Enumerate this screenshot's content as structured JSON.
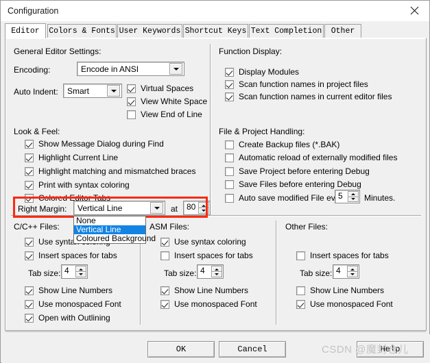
{
  "window": {
    "title": "Configuration",
    "close_icon": "close-icon"
  },
  "tabs": [
    {
      "label": "Editor",
      "active": true
    },
    {
      "label": "Colors & Fonts",
      "active": false
    },
    {
      "label": "User Keywords",
      "active": false
    },
    {
      "label": "Shortcut Keys",
      "active": false
    },
    {
      "label": "Text Completion",
      "active": false
    },
    {
      "label": "Other",
      "active": false
    }
  ],
  "general_editor": {
    "group_label": "General Editor Settings:",
    "encoding_label": "Encoding:",
    "encoding_value": "Encode in ANSI",
    "auto_indent_label": "Auto Indent:",
    "auto_indent_value": "Smart",
    "checks": [
      {
        "label": "Virtual Spaces",
        "checked": true
      },
      {
        "label": "View White Space",
        "checked": true
      },
      {
        "label": "View End of Line",
        "checked": false
      }
    ]
  },
  "function_display": {
    "group_label": "Function Display:",
    "checks": [
      {
        "label": "Display Modules",
        "checked": true
      },
      {
        "label": "Scan function names in project files",
        "checked": true
      },
      {
        "label": "Scan function names in current editor files",
        "checked": true
      }
    ]
  },
  "look_feel": {
    "group_label": "Look & Feel:",
    "checks": [
      {
        "label": "Show Message Dialog during Find",
        "checked": true
      },
      {
        "label": "Highlight Current Line",
        "checked": true
      },
      {
        "label": "Highlight matching and mismatched braces",
        "checked": true
      },
      {
        "label": "Print with syntax coloring",
        "checked": true
      },
      {
        "label": "Colored Editor Tabs",
        "checked": true
      }
    ],
    "right_margin_label": "Right Margin:",
    "right_margin_value": "Vertical Line",
    "at_label": "at",
    "at_value": "80",
    "dropdown_open": true,
    "dropdown_options": [
      {
        "label": "None",
        "selected": false
      },
      {
        "label": "Vertical Line",
        "selected": true
      },
      {
        "label": "Coloured Background",
        "selected": false
      }
    ]
  },
  "file_project": {
    "group_label": "File & Project Handling:",
    "checks": [
      {
        "label": "Create Backup files (*.BAK)",
        "checked": false
      },
      {
        "label": "Automatic reload of externally modified files",
        "checked": false
      },
      {
        "label": "Save Project before entering Debug",
        "checked": false
      },
      {
        "label": "Save Files before entering Debug",
        "checked": false
      },
      {
        "label": "Auto save modified File every",
        "checked": false
      }
    ],
    "autosave_minutes": "5",
    "autosave_suffix": "Minutes."
  },
  "cpp_files": {
    "group_label": "C/C++ Files:",
    "checks_top": [
      {
        "label": "Use syntax coloring",
        "checked": true
      },
      {
        "label": "Insert spaces for tabs",
        "checked": true
      }
    ],
    "tab_size_label": "Tab size:",
    "tab_size_value": "4",
    "checks_bottom": [
      {
        "label": "Show Line Numbers",
        "checked": true
      },
      {
        "label": "Use monospaced Font",
        "checked": true
      },
      {
        "label": "Open with Outlining",
        "checked": true
      }
    ]
  },
  "asm_files": {
    "group_label": "ASM Files:",
    "checks_top": [
      {
        "label": "Use syntax coloring",
        "checked": true
      },
      {
        "label": "Insert spaces for tabs",
        "checked": false
      }
    ],
    "tab_size_label": "Tab size:",
    "tab_size_value": "4",
    "checks_bottom": [
      {
        "label": "Show Line Numbers",
        "checked": true
      },
      {
        "label": "Use monospaced Font",
        "checked": true
      }
    ]
  },
  "other_files": {
    "group_label": "Other Files:",
    "checks_top": [
      {
        "label": "Insert spaces for tabs",
        "checked": false
      }
    ],
    "tab_size_label": "Tab size:",
    "tab_size_value": "4",
    "checks_bottom": [
      {
        "label": "Show Line Numbers",
        "checked": false
      },
      {
        "label": "Use monospaced Font",
        "checked": true
      }
    ]
  },
  "buttons": {
    "ok": "OK",
    "cancel": "Cancel",
    "help": "Help"
  },
  "watermark": {
    "text": "CSDN @魔封仓儿"
  },
  "colors": {
    "highlight_blue": "#1383e4",
    "annotation_red": "#fa2a13",
    "dialog_face": "#f0f0f0"
  }
}
